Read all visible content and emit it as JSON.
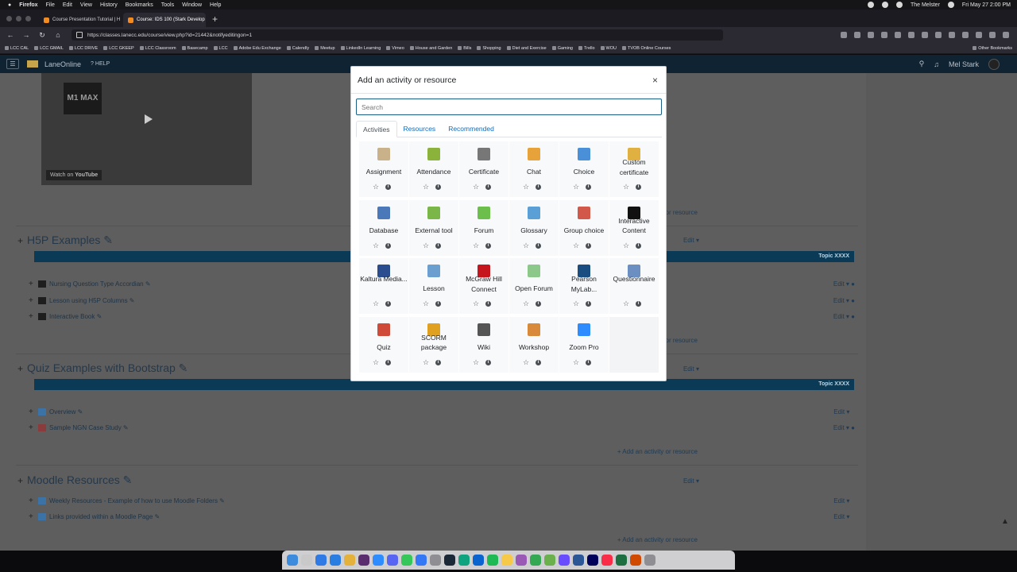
{
  "menubar": {
    "apple": "",
    "items": [
      "Firefox",
      "File",
      "Edit",
      "View",
      "History",
      "Bookmarks",
      "Tools",
      "Window",
      "Help"
    ],
    "user": "The Melster",
    "clock": "Fri May 27  2:00 PM"
  },
  "browser": {
    "tabs": [
      {
        "label": "Course Presentation Tutorial | H",
        "active": false
      },
      {
        "label": "Course: IDS 100 (Stark Develop",
        "active": true
      }
    ],
    "url": "https://classes.lanecc.edu/course/view.php?id=21442&notifyeditingon=1",
    "bookmarks": [
      "LCC CAL",
      "LCC GMAIL",
      "LCC DRIVE",
      "LCC GKEEP",
      "LCC Classroom",
      "Basecamp",
      "LCC",
      "Adobe Edu Exchange",
      "Calendly",
      "Meetup",
      "LinkedIn Learning",
      "Vimeo",
      "House and Garden",
      "Bills",
      "Shopping",
      "Diet and Exercise",
      "Gaming",
      "Trello",
      "WOU",
      "TVOB Online Courses"
    ],
    "other_bookmarks": "Other Bookmarks"
  },
  "moodle": {
    "brand": "LaneOnline",
    "help": "? HELP",
    "user": "Mel Stark",
    "video": {
      "watch_on": "Watch on",
      "youtube": "YouTube",
      "mac_text": "M1 MAX"
    },
    "add_activity": "Add an activity or resource",
    "edit": "Edit",
    "sections": [
      {
        "title": "H5P Examples",
        "topic": "Topic XXXX",
        "activities": [
          "Nursing Question Type Accordian",
          "Lesson using H5P Columns",
          "Interactive Book"
        ]
      },
      {
        "title": "Quiz Examples with Bootstrap",
        "topic": "Topic XXXX",
        "activities": [
          "Overview",
          "Sample NGN Case Study"
        ]
      },
      {
        "title": "Moodle Resources",
        "topic": "",
        "activities": [
          "Weekly Resources - Example of how to use Moodle Folders",
          "Links provided within a Moodle Page"
        ]
      }
    ]
  },
  "modal": {
    "title": "Add an activity or resource",
    "close": "×",
    "search_placeholder": "Search",
    "tabs": [
      "Activities",
      "Resources",
      "Recommended"
    ],
    "active_tab": "Activities",
    "items": [
      {
        "label": "Assignment",
        "icon": "assignment-icon",
        "color": "#c9b18a"
      },
      {
        "label": "Attendance",
        "icon": "attendance-icon",
        "color": "#8bb33b"
      },
      {
        "label": "Certificate",
        "icon": "certificate-icon",
        "color": "#777777"
      },
      {
        "label": "Chat",
        "icon": "chat-icon",
        "color": "#e8a23a"
      },
      {
        "label": "Choice",
        "icon": "choice-icon",
        "color": "#4a90d9"
      },
      {
        "label": "Custom certificate",
        "icon": "custom-certificate-icon",
        "color": "#e0b040"
      },
      {
        "label": "Database",
        "icon": "database-icon",
        "color": "#4a78b8"
      },
      {
        "label": "External tool",
        "icon": "external-tool-icon",
        "color": "#7ab648"
      },
      {
        "label": "Forum",
        "icon": "forum-icon",
        "color": "#6cbf4a"
      },
      {
        "label": "Glossary",
        "icon": "glossary-icon",
        "color": "#5a9fd6"
      },
      {
        "label": "Group choice",
        "icon": "group-choice-icon",
        "color": "#d2584a"
      },
      {
        "label": "Interactive Content",
        "icon": "h5p-icon",
        "color": "#111111"
      },
      {
        "label": "Kaltura Media...",
        "icon": "kaltura-icon",
        "color": "#2a4d8f"
      },
      {
        "label": "Lesson",
        "icon": "lesson-icon",
        "color": "#6a9fd0"
      },
      {
        "label": "McGraw Hill Connect",
        "icon": "mcgraw-hill-icon",
        "color": "#c4161c"
      },
      {
        "label": "Open Forum",
        "icon": "open-forum-icon",
        "color": "#8cc88a"
      },
      {
        "label": "Pearson MyLab...",
        "icon": "pearson-icon",
        "color": "#1a4d80"
      },
      {
        "label": "Questionnaire",
        "icon": "questionnaire-icon",
        "color": "#6a8fc0"
      },
      {
        "label": "Quiz",
        "icon": "quiz-icon",
        "color": "#d04a3a"
      },
      {
        "label": "SCORM package",
        "icon": "scorm-icon",
        "color": "#e0a020"
      },
      {
        "label": "Wiki",
        "icon": "wiki-icon",
        "color": "#555555"
      },
      {
        "label": "Workshop",
        "icon": "workshop-icon",
        "color": "#d88a3a"
      },
      {
        "label": "Zoom Pro",
        "icon": "zoom-icon",
        "color": "#2d8cff"
      }
    ]
  },
  "dock": {
    "apps": [
      "finder",
      "launchpad",
      "app-store",
      "safari",
      "chrome",
      "slack",
      "zoom",
      "discord",
      "messages",
      "mail",
      "settings",
      "steam",
      "chatgpt",
      "outlook",
      "spotify",
      "notes",
      "podcasts",
      "maps",
      "vpn",
      "affinity",
      "word",
      "audition",
      "music",
      "excel",
      "keynote",
      "trash"
    ]
  }
}
